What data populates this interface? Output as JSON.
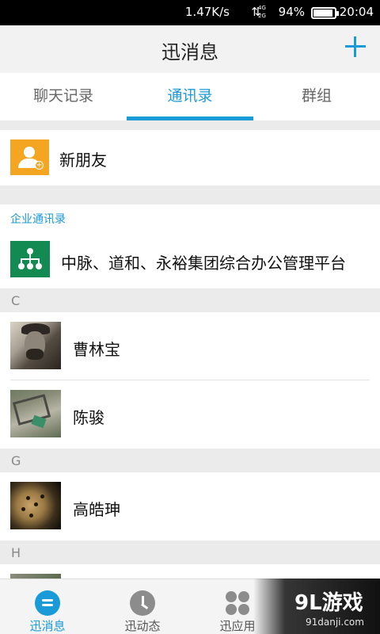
{
  "status_bar": {
    "speed": "1.47K/s",
    "network_top": "4G",
    "network_bottom": "2G",
    "battery_percent": "94%",
    "battery_level": 0.94,
    "time": "20:04"
  },
  "header": {
    "title": "迅消息",
    "add_icon": "plus-icon"
  },
  "tabs": [
    {
      "label": "聊天记录",
      "active": false
    },
    {
      "label": "通讯录",
      "active": true
    },
    {
      "label": "群组",
      "active": false
    }
  ],
  "new_friend": {
    "label": "新朋友",
    "icon": "add-user-icon"
  },
  "enterprise": {
    "section_title": "企业通讯录",
    "org_name": "中脉、道和、永裕集团综合办公管理平台",
    "icon": "org-chart-icon"
  },
  "contact_groups": [
    {
      "letter": "C",
      "contacts": [
        {
          "name": "曹林宝"
        },
        {
          "name": "陈骏"
        }
      ]
    },
    {
      "letter": "G",
      "contacts": [
        {
          "name": "高皓珅"
        }
      ]
    },
    {
      "letter": "H",
      "contacts": []
    }
  ],
  "bottom_nav": [
    {
      "label": "迅消息",
      "icon": "chat-bubble-icon",
      "active": true
    },
    {
      "label": "迅动态",
      "icon": "clock-icon",
      "active": false
    },
    {
      "label": "迅应用",
      "icon": "apps-icon",
      "active": false
    }
  ],
  "watermark": {
    "logo_text": "9L游戏",
    "site": "91danji.com"
  },
  "colors": {
    "accent": "#1a9ad7",
    "new_friend_bg": "#f4a521",
    "org_icon_bg": "#138a51",
    "section_bg": "#ebebeb"
  }
}
